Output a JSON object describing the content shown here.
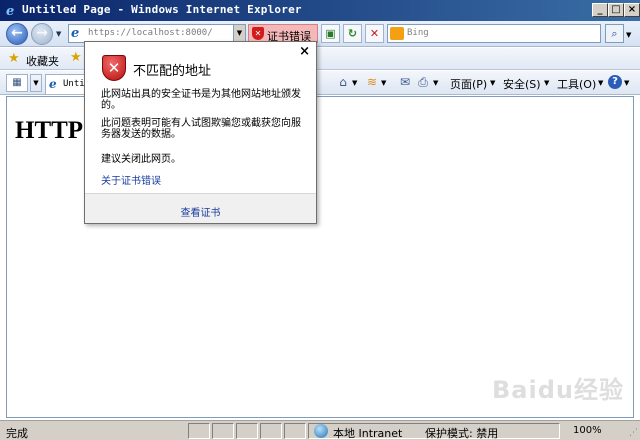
{
  "window": {
    "title": "Untitled Page - Windows Internet Explorer",
    "minimize": "_",
    "maximize": "□",
    "close": "×"
  },
  "address_bar": {
    "url": "https://localhost:8000/",
    "cert_error_label": "证书错误",
    "search_placeholder": "Bing"
  },
  "favorites_bar": {
    "label": "收藏夹"
  },
  "tab": {
    "label": "Untitled Page"
  },
  "command_bar": {
    "page_menu": "页面(P)",
    "safety_menu": "安全(S)",
    "tools_menu": "工具(O)"
  },
  "content": {
    "heading": "HTTP"
  },
  "cert_popup": {
    "title": "不匹配的地址",
    "paragraph1": "此网站出具的安全证书是为其他网站地址颁发的。",
    "paragraph2": "此问题表明可能有人试图欺骗您或截获您向服务器发送的数据。",
    "paragraph3": "建议关闭此网页。",
    "link": "关于证书错误",
    "view_cert": "查看证书"
  },
  "status_bar": {
    "status": "完成",
    "zone": "本地 Intranet",
    "protected_mode": "保护模式: 禁用",
    "zoom": "100%"
  },
  "watermark": "Baidu经验",
  "colors": {
    "titlebar_start": "#0a246a",
    "titlebar_end": "#3a6ea5",
    "cert_error_bg": "#f5b8b8",
    "link": "#1a3d9e"
  }
}
